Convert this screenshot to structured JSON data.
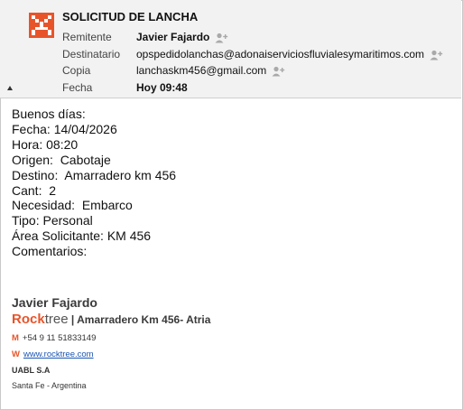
{
  "message": {
    "subject": "SOLICITUD DE LANCHA",
    "fields": [
      {
        "label": "Remitente",
        "value": "Javier Fajardo"
      },
      {
        "label": "Destinatario",
        "value": "opspedidolanchas@adonaiserviciosfluvialesymaritimos.com"
      },
      {
        "label": "Copia",
        "value": "lanchaskm456@gmail.com"
      },
      {
        "label": "Fecha",
        "value": "Hoy 09:48"
      }
    ],
    "icons": {
      "logo": "sender-logo-icon",
      "contact": "add-contact-icon",
      "collapse": "collapse-arrow-icon"
    },
    "accent_color": "#e8542a"
  },
  "body": {
    "lines": [
      "Buenos días:",
      "Fecha: 14/04/2026",
      "Hora: 08:20",
      "Origen:  Cabotaje",
      "Destino:  Amarradero km 456",
      "Cant:  2",
      "Necesidad:  Embarco",
      "Tipo: Personal",
      "Área Solicitante: KM 456",
      "Comentarios:"
    ]
  },
  "signature": {
    "name": "Javier Fajardo",
    "brand_rock": "Rock",
    "brand_tree": "tree",
    "separator": " | ",
    "branch": "Amarradero Km 456- Atria",
    "phone_key": "M",
    "phone": "+54 9 11 51833149",
    "web_key": "W",
    "web": "www.rocktree.com",
    "company": "UABL S.A",
    "location": "Santa Fe - Argentina"
  }
}
